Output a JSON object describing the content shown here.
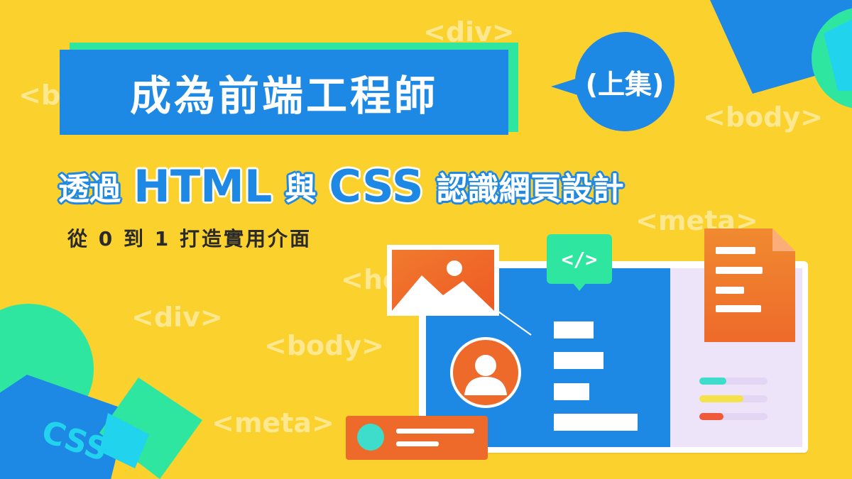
{
  "title": {
    "main": "成為前端工程師",
    "bubble": "(上集)"
  },
  "subtitle": {
    "part1": "透過",
    "html": "HTML",
    "part2": "與",
    "css": "CSS",
    "part3": "認識網頁設計"
  },
  "tagline": "從 0 到 1 打造實用介面",
  "background_tags": {
    "div_top": "<div>",
    "body_partial_left": "<bo",
    "body_right": "<body>",
    "meta_right": "<meta>",
    "he_partial": "<he",
    "div_mid": "<div>",
    "body_mid": "<body>",
    "meta_bottom": "<meta>"
  },
  "code_tag": "</>",
  "css_badge": "CSS",
  "colors": {
    "background": "#FBD12E",
    "brand_blue": "#1E88E5",
    "accent_green": "#2EE6A0",
    "accent_orange": "#EE6A2A",
    "accent_cyan": "#22D3EE",
    "panel_lavender": "#EEE4FA"
  },
  "icons": [
    "image-icon",
    "code-icon",
    "user-icon",
    "document-icon"
  ]
}
